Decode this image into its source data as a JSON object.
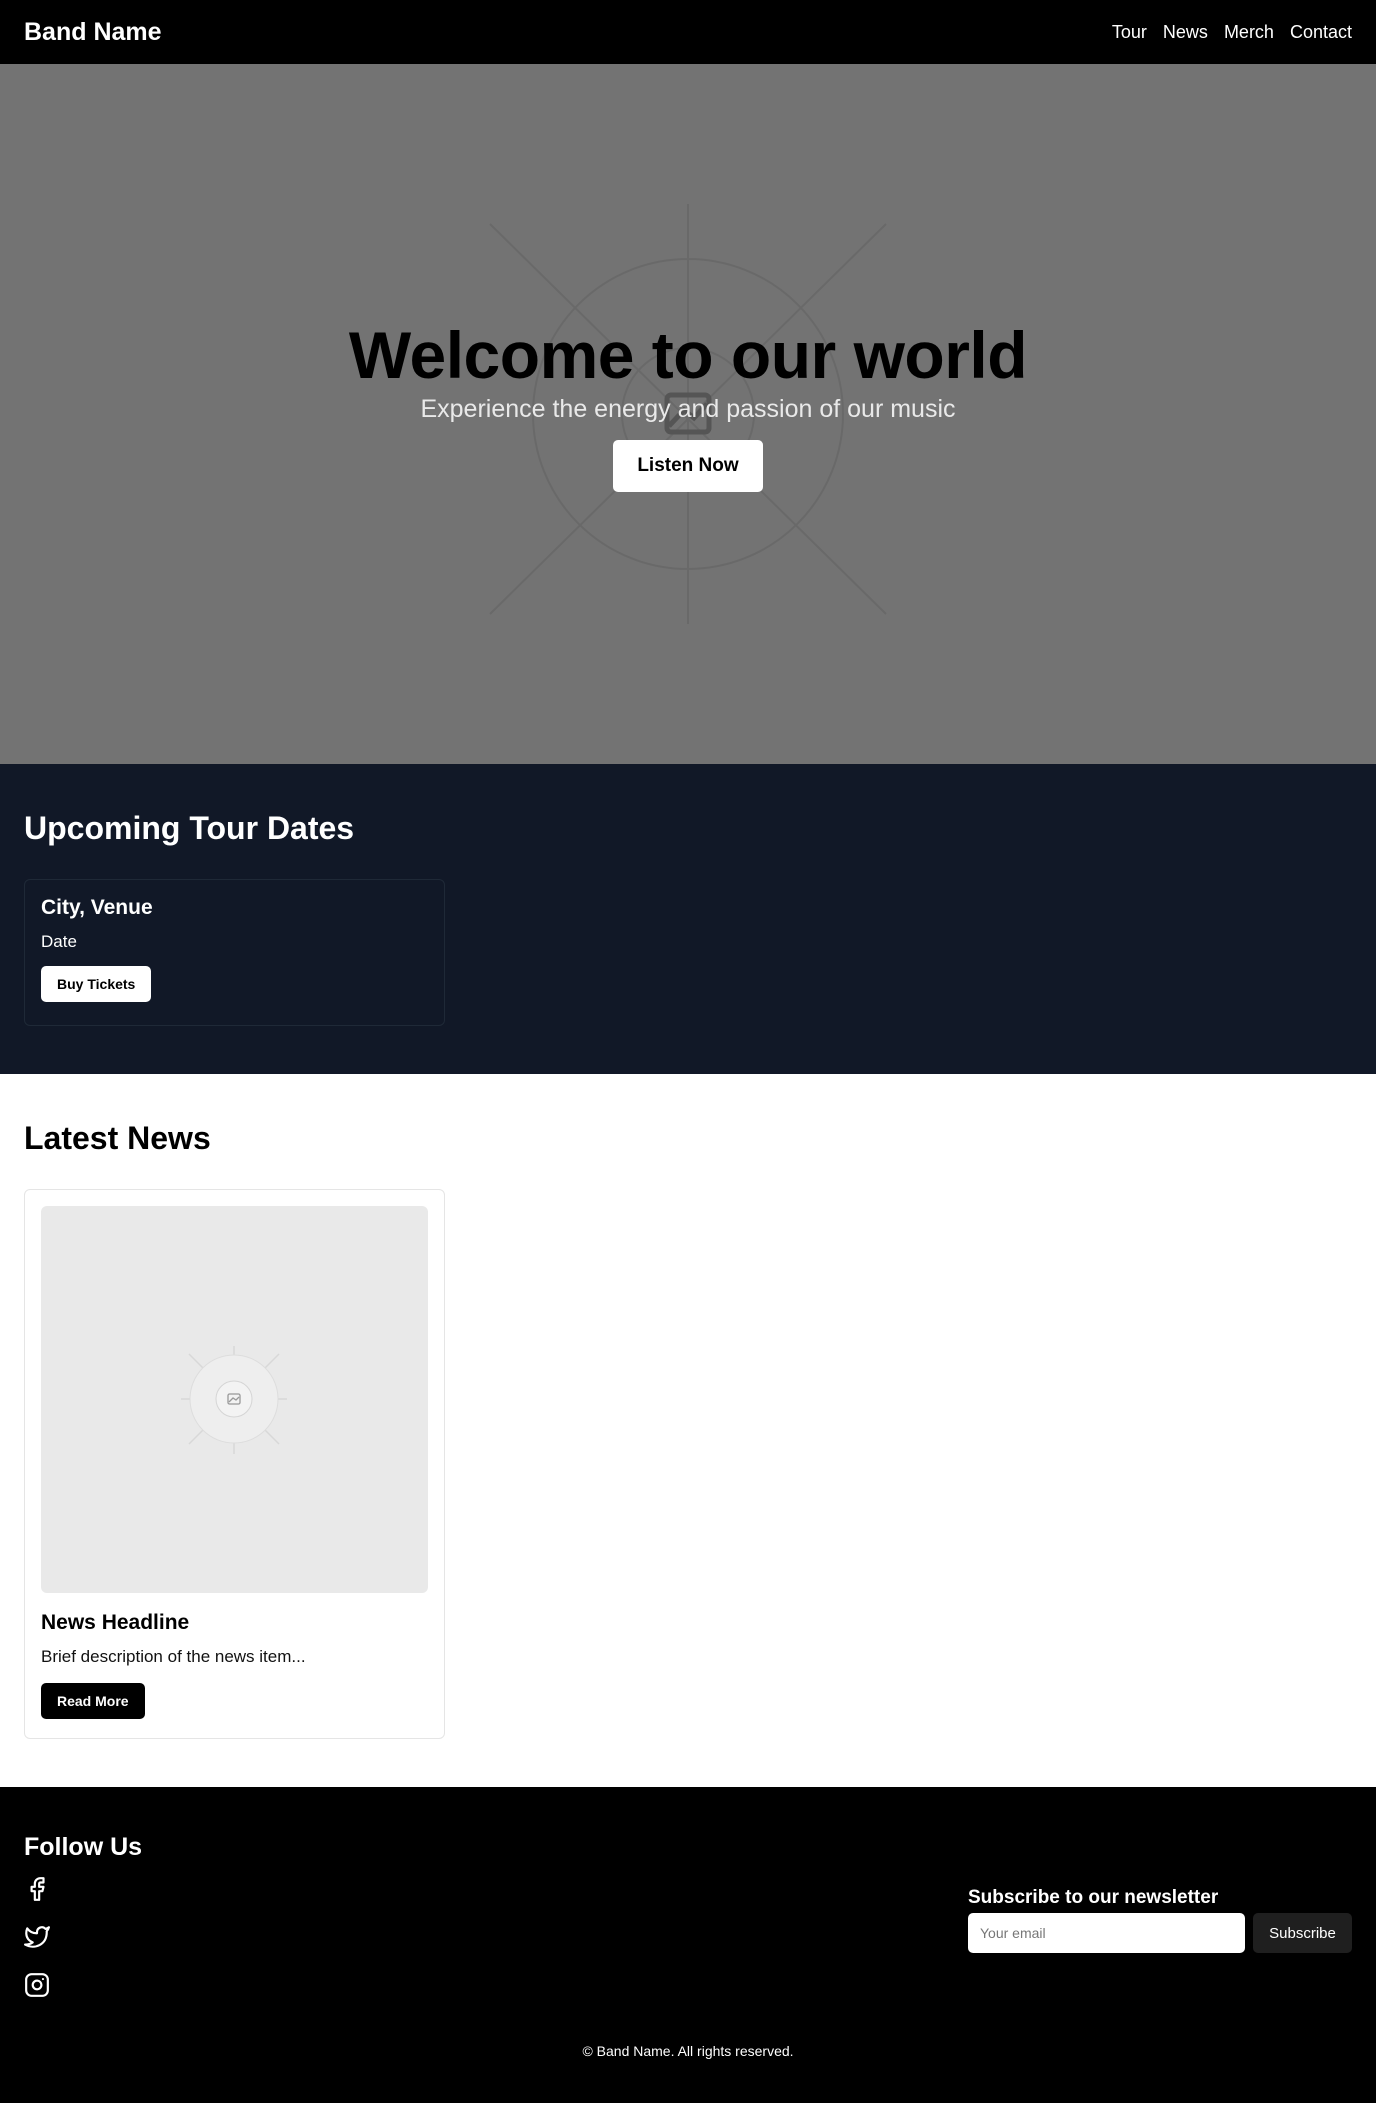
{
  "nav": {
    "brand": "Band Name",
    "links": [
      "Tour",
      "News",
      "Merch",
      "Contact"
    ]
  },
  "hero": {
    "title": "Welcome to our world",
    "subtitle": "Experience the energy and passion of our music",
    "button": "Listen Now",
    "image_icon": "image-placeholder-icon"
  },
  "tour": {
    "title": "Upcoming Tour Dates",
    "card": {
      "city_venue": "City, Venue",
      "date": "Date",
      "button": "Buy Tickets"
    }
  },
  "news": {
    "title": "Latest News",
    "card": {
      "headline": "News Headline",
      "description": "Brief description of the news item...",
      "button": "Read More",
      "image_icon": "image-placeholder-icon"
    }
  },
  "footer": {
    "follow_title": "Follow Us",
    "social_icons": [
      "facebook-icon",
      "twitter-icon",
      "instagram-icon"
    ],
    "newsletter_title": "Subscribe to our newsletter",
    "email_placeholder": "Your email",
    "subscribe_button": "Subscribe",
    "copyright": "© Band Name. All rights reserved."
  },
  "colors": {
    "nav_bg": "#000000",
    "hero_bg": "#737373",
    "tour_bg": "#111827",
    "footer_bg": "#000000"
  }
}
